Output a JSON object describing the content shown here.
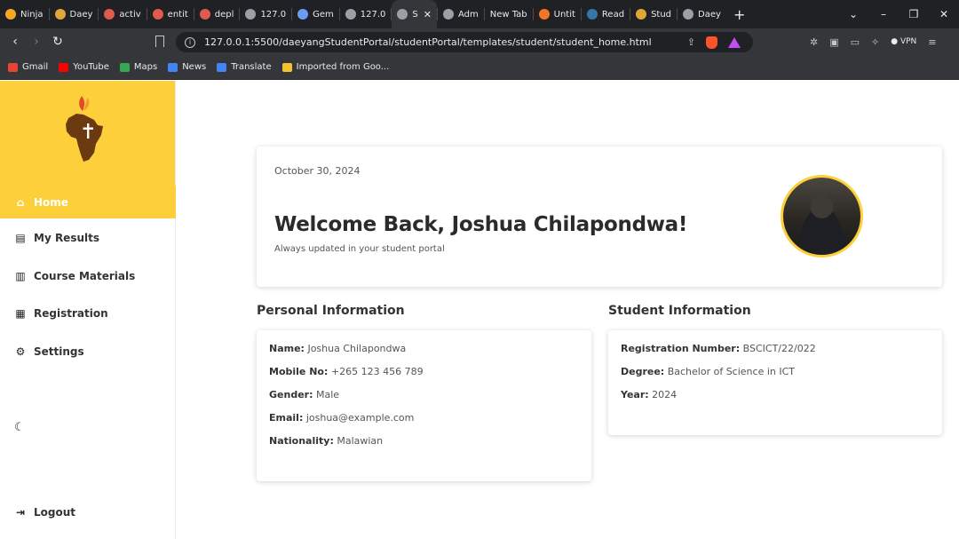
{
  "browser": {
    "tabs": [
      {
        "title": "Ninja",
        "icon_color": "#f6a623"
      },
      {
        "title": "Daey",
        "icon_color": "#e0a63a"
      },
      {
        "title": "activ",
        "icon_color": "#e05a4e"
      },
      {
        "title": "entit",
        "icon_color": "#e05a4e"
      },
      {
        "title": "depl",
        "icon_color": "#e05a4e"
      },
      {
        "title": "127.0",
        "icon_color": "#9aa0a6"
      },
      {
        "title": "Gem",
        "icon_color": "#6b9cf5"
      },
      {
        "title": "127.0",
        "icon_color": "#9aa0a6"
      },
      {
        "title": "S",
        "icon_color": "#9aa0a6",
        "active": true
      },
      {
        "title": "Adm",
        "icon_color": "#9aa0a6"
      },
      {
        "title": "New Tab",
        "icon_color": ""
      },
      {
        "title": "Untit",
        "icon_color": "#f37626"
      },
      {
        "title": "Read",
        "icon_color": "#3776ab"
      },
      {
        "title": "Stud",
        "icon_color": "#e0a63a"
      },
      {
        "title": "Daey",
        "icon_color": "#9aa0a6"
      }
    ],
    "url": "127.0.0.1:5500/daeyangStudentPortal/studentPortal/templates/student/student_home.html",
    "vpn_label": "VPN",
    "bookmarks": [
      {
        "label": "Gmail",
        "icon_color": "#ea4335"
      },
      {
        "label": "YouTube",
        "icon_color": "#ff0000"
      },
      {
        "label": "Maps",
        "icon_color": "#34a853"
      },
      {
        "label": "News",
        "icon_color": "#4285f4"
      },
      {
        "label": "Translate",
        "icon_color": "#4285f4"
      },
      {
        "label": "Imported from Goo...",
        "icon_color": "#f4c430"
      }
    ]
  },
  "sidebar": {
    "brand_color": "#fdd03b",
    "active_item": "Home",
    "items": [
      {
        "label": "My Results",
        "icon": "chart-icon"
      },
      {
        "label": "Course Materials",
        "icon": "book-icon"
      },
      {
        "label": "Registration",
        "icon": "clipboard-icon"
      },
      {
        "label": "Settings",
        "icon": "gear-icon"
      }
    ],
    "logout": "Logout"
  },
  "welcome": {
    "date": "October 30, 2024",
    "heading": "Welcome Back, Joshua Chilapondwa!",
    "subtitle": "Always updated in your student portal"
  },
  "personal": {
    "title": "Personal Information",
    "rows": [
      {
        "label": "Name:",
        "value": "Joshua Chilapondwa"
      },
      {
        "label": "Mobile No:",
        "value": "+265 123 456 789"
      },
      {
        "label": "Gender:",
        "value": "Male"
      },
      {
        "label": "Email:",
        "value": "joshua@example.com"
      },
      {
        "label": "Nationality:",
        "value": "Malawian"
      }
    ]
  },
  "student": {
    "title": "Student Information",
    "rows": [
      {
        "label": "Registration Number:",
        "value": "BSCICT/22/022"
      },
      {
        "label": "Degree:",
        "value": "Bachelor of Science in ICT"
      },
      {
        "label": "Year:",
        "value": "2024"
      }
    ]
  }
}
